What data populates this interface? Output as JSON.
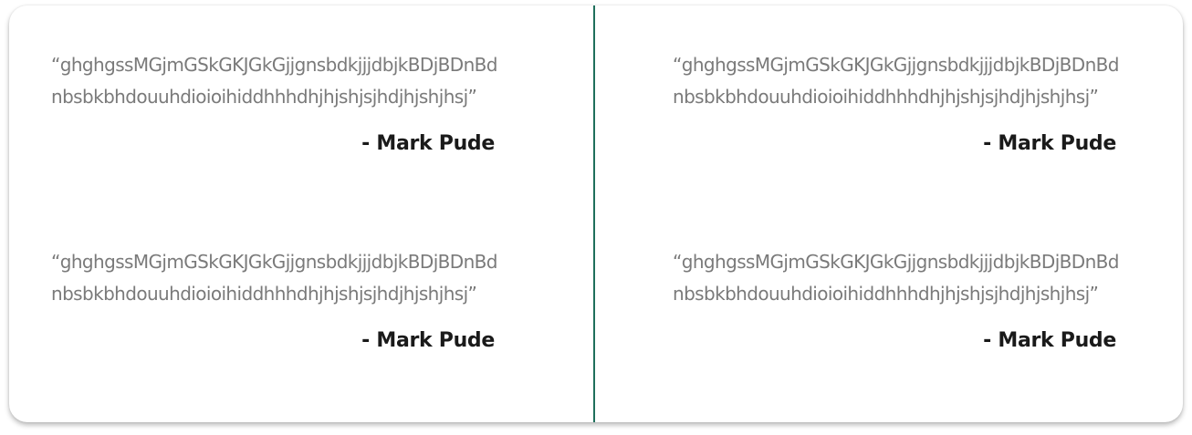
{
  "testimonials": [
    {
      "quote": "“ghghgssMGjmGSkGKJGkGjjgnsbdkjjjdbjkBDjBDnBdnbsbkbhdouuhdioioihiddhhhdhjhjshjsjhdjhjshjhsj”",
      "author": "- Mark Pude"
    },
    {
      "quote": "“ghghgssMGjmGSkGKJGkGjjgnsbdkjjjdbjkBDjBDnBdnbsbkbhdouuhdioioihiddhhhdhjhjshjsjhdjhjshjhsj”",
      "author": "- Mark Pude"
    },
    {
      "quote": "“ghghgssMGjmGSkGKJGkGjjgnsbdkjjjdbjkBDjBDnBdnbsbkbhdouuhdioioihiddhhhdhjhjshjsjhdjhjshjhsj”",
      "author": "- Mark Pude"
    },
    {
      "quote": "“ghghgssMGjmGSkGKJGkGjjgnsbdkjjjdbjkBDjBDnBdnbsbkbhdouuhdioioihiddhhhdhjhjshjsjhdjhjshjhsj”",
      "author": "- Mark Pude"
    }
  ],
  "colors": {
    "divider": "#1f6f5c",
    "quote_text": "#7a7a7a",
    "author_text": "#1a1a1a"
  }
}
